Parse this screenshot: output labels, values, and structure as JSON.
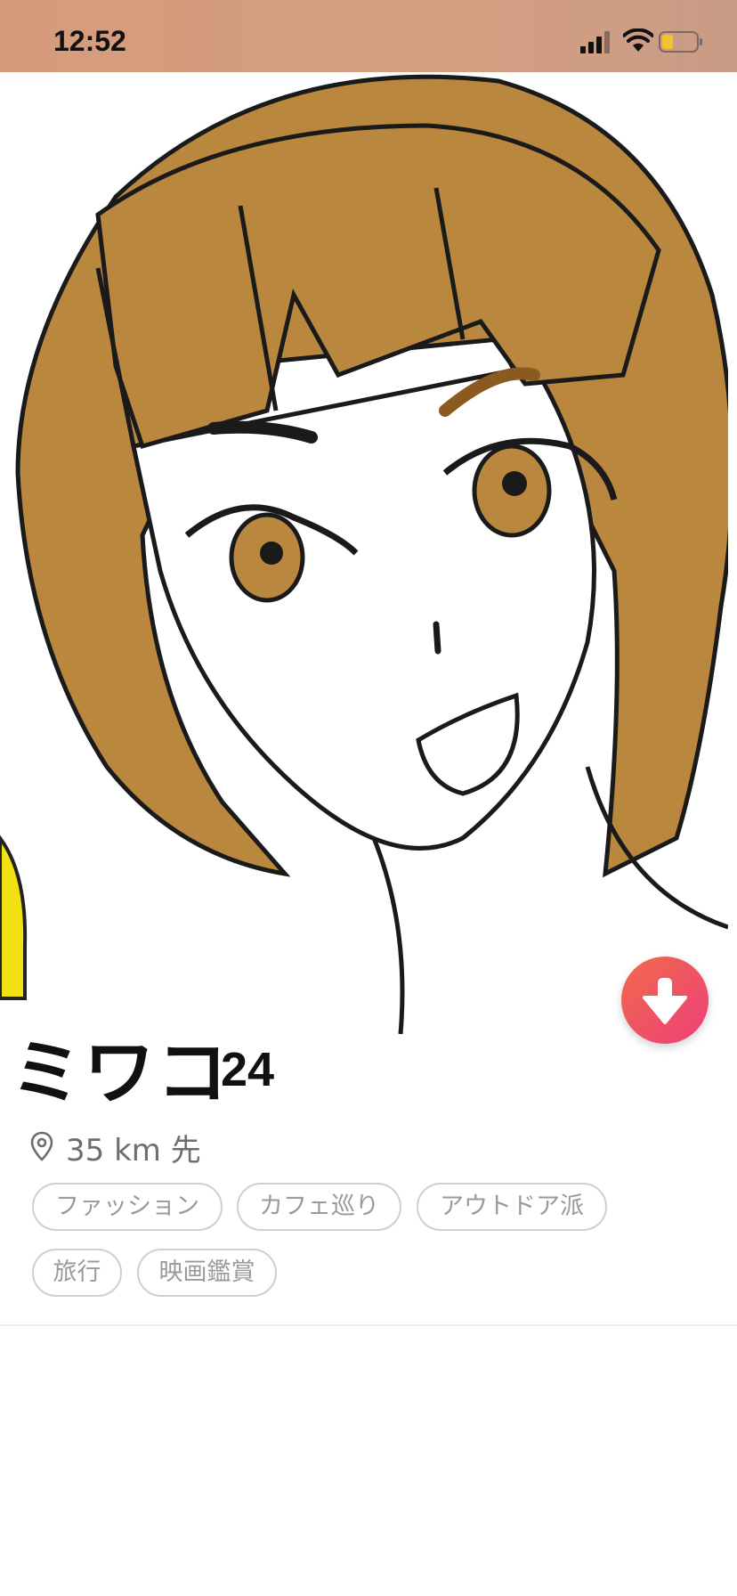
{
  "status_bar": {
    "time": "12:52"
  },
  "profile": {
    "name": "ミワコ",
    "age": "24",
    "distance": "35 km 先",
    "tags": [
      "ファッション",
      "カフェ巡り",
      "アウトドア派",
      "旅行",
      "映画鑑賞"
    ]
  },
  "icons": {
    "collapse": "arrow-down-icon",
    "location": "location-pin-icon"
  },
  "colors": {
    "status_bar": "#d59b7c",
    "accent_gradient_start": "#f06a4c",
    "accent_gradient_end": "#ee3f7a",
    "hair": "#b9873e",
    "tag_text": "#9a9a9a"
  }
}
